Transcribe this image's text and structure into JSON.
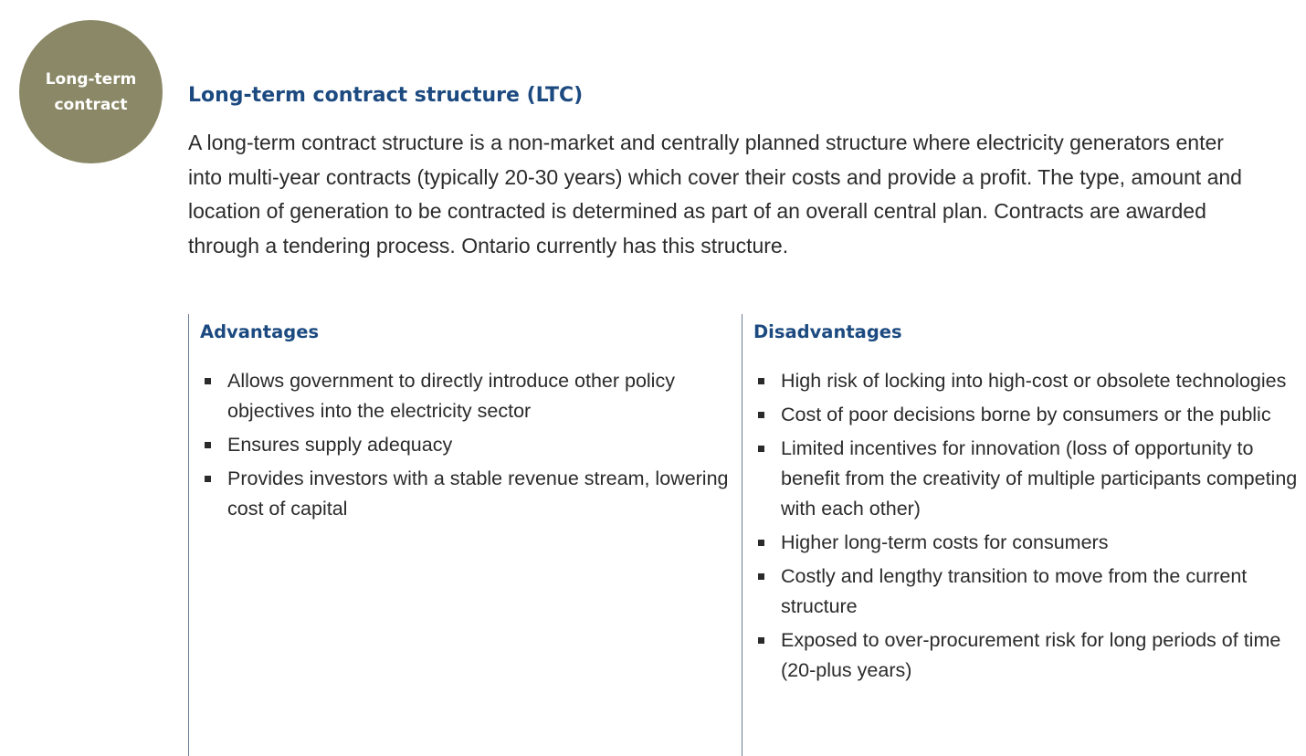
{
  "badge": {
    "line1": "Long-term",
    "line2": "contract"
  },
  "title": "Long-term contract structure (LTC)",
  "intro": "A long-term contract structure is a non-market and centrally planned structure where electricity generators enter into multi-year contracts (typically 20-30 years) which cover their costs and provide a profit. The type, amount and location of generation to be contracted is determined as part of an overall central plan. Contracts are awarded through a tendering process. Ontario currently has this structure.",
  "advantages": {
    "heading": "Advantages",
    "items": [
      "Allows government to directly introduce other policy objectives into the electricity sector",
      "Ensures supply adequacy",
      "Provides investors with a stable revenue stream, lowering cost of capital"
    ]
  },
  "disadvantages": {
    "heading": "Disadvantages",
    "items": [
      "High risk of locking into high-cost or obsolete technologies",
      "Cost of poor decisions borne by consumers or the public",
      "Limited incentives for innovation (loss of opportunity to benefit from the creativity of multiple participants competing with each other)",
      "Higher long-term costs for consumers",
      "Costly and lengthy transition to move from the current structure",
      "Exposed to over-procurement risk for long periods of time (20-plus years)"
    ]
  }
}
